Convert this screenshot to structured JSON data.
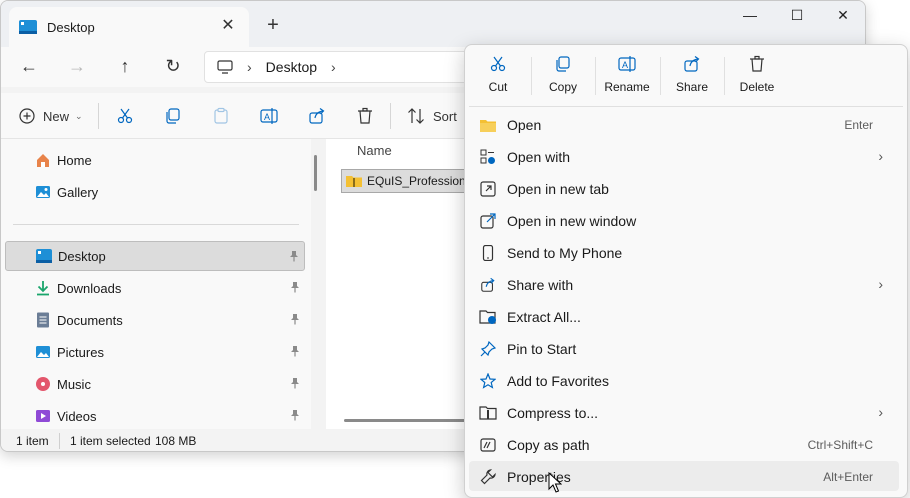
{
  "window": {
    "tab_title": "Desktop",
    "close_tab_glyph": "✕",
    "new_tab_glyph": "+",
    "minimize_glyph": "—",
    "maximize_glyph": "☐",
    "close_glyph": "✕"
  },
  "nav": {
    "back_glyph": "←",
    "forward_glyph": "→",
    "up_glyph": "↑",
    "refresh_glyph": "↻",
    "sep_glyph": "›",
    "breadcrumb": "Desktop"
  },
  "commandbar": {
    "new_label": "New",
    "sort_label": "Sort"
  },
  "sidebar": {
    "items": [
      {
        "label": "Home",
        "icon": "home-icon"
      },
      {
        "label": "Gallery",
        "icon": "gallery-icon"
      },
      {
        "label": "Desktop",
        "icon": "desktop-icon",
        "selected": true
      },
      {
        "label": "Downloads",
        "icon": "downloads-icon"
      },
      {
        "label": "Documents",
        "icon": "documents-icon"
      },
      {
        "label": "Pictures",
        "icon": "pictures-icon"
      },
      {
        "label": "Music",
        "icon": "music-icon"
      },
      {
        "label": "Videos",
        "icon": "videos-icon"
      }
    ]
  },
  "content": {
    "column_name": "Name",
    "file_name": "EQuIS_Professional"
  },
  "status": {
    "item_count": "1 item",
    "selected": "1 item selected",
    "size": "108 MB"
  },
  "context_menu": {
    "top_actions": [
      {
        "label": "Cut",
        "icon": "scissors-icon"
      },
      {
        "label": "Copy",
        "icon": "copy-icon"
      },
      {
        "label": "Rename",
        "icon": "rename-icon"
      },
      {
        "label": "Share",
        "icon": "share-icon"
      },
      {
        "label": "Delete",
        "icon": "trash-icon"
      }
    ],
    "items": [
      {
        "label": "Open",
        "shortcut": "Enter",
        "icon": "folder-icon"
      },
      {
        "label": "Open with",
        "submenu": "›",
        "icon": "open-with-icon"
      },
      {
        "label": "Open in new tab",
        "icon": "new-tab-icon"
      },
      {
        "label": "Open in new window",
        "icon": "new-window-icon"
      },
      {
        "label": "Send to My Phone",
        "icon": "phone-icon"
      },
      {
        "label": "Share with",
        "submenu": "›",
        "icon": "share-with-icon"
      },
      {
        "label": "Extract All...",
        "icon": "extract-icon"
      },
      {
        "label": "Pin to Start",
        "icon": "pin-icon"
      },
      {
        "label": "Add to Favorites",
        "icon": "star-icon"
      },
      {
        "label": "Compress to...",
        "submenu": "›",
        "icon": "compress-icon"
      },
      {
        "label": "Copy as path",
        "shortcut": "Ctrl+Shift+C",
        "icon": "copy-path-icon"
      },
      {
        "label": "Properties",
        "shortcut": "Alt+Enter",
        "icon": "wrench-icon"
      }
    ]
  },
  "colors": {
    "accent": "#0067c0",
    "folder_yellow": "#f4c033"
  }
}
